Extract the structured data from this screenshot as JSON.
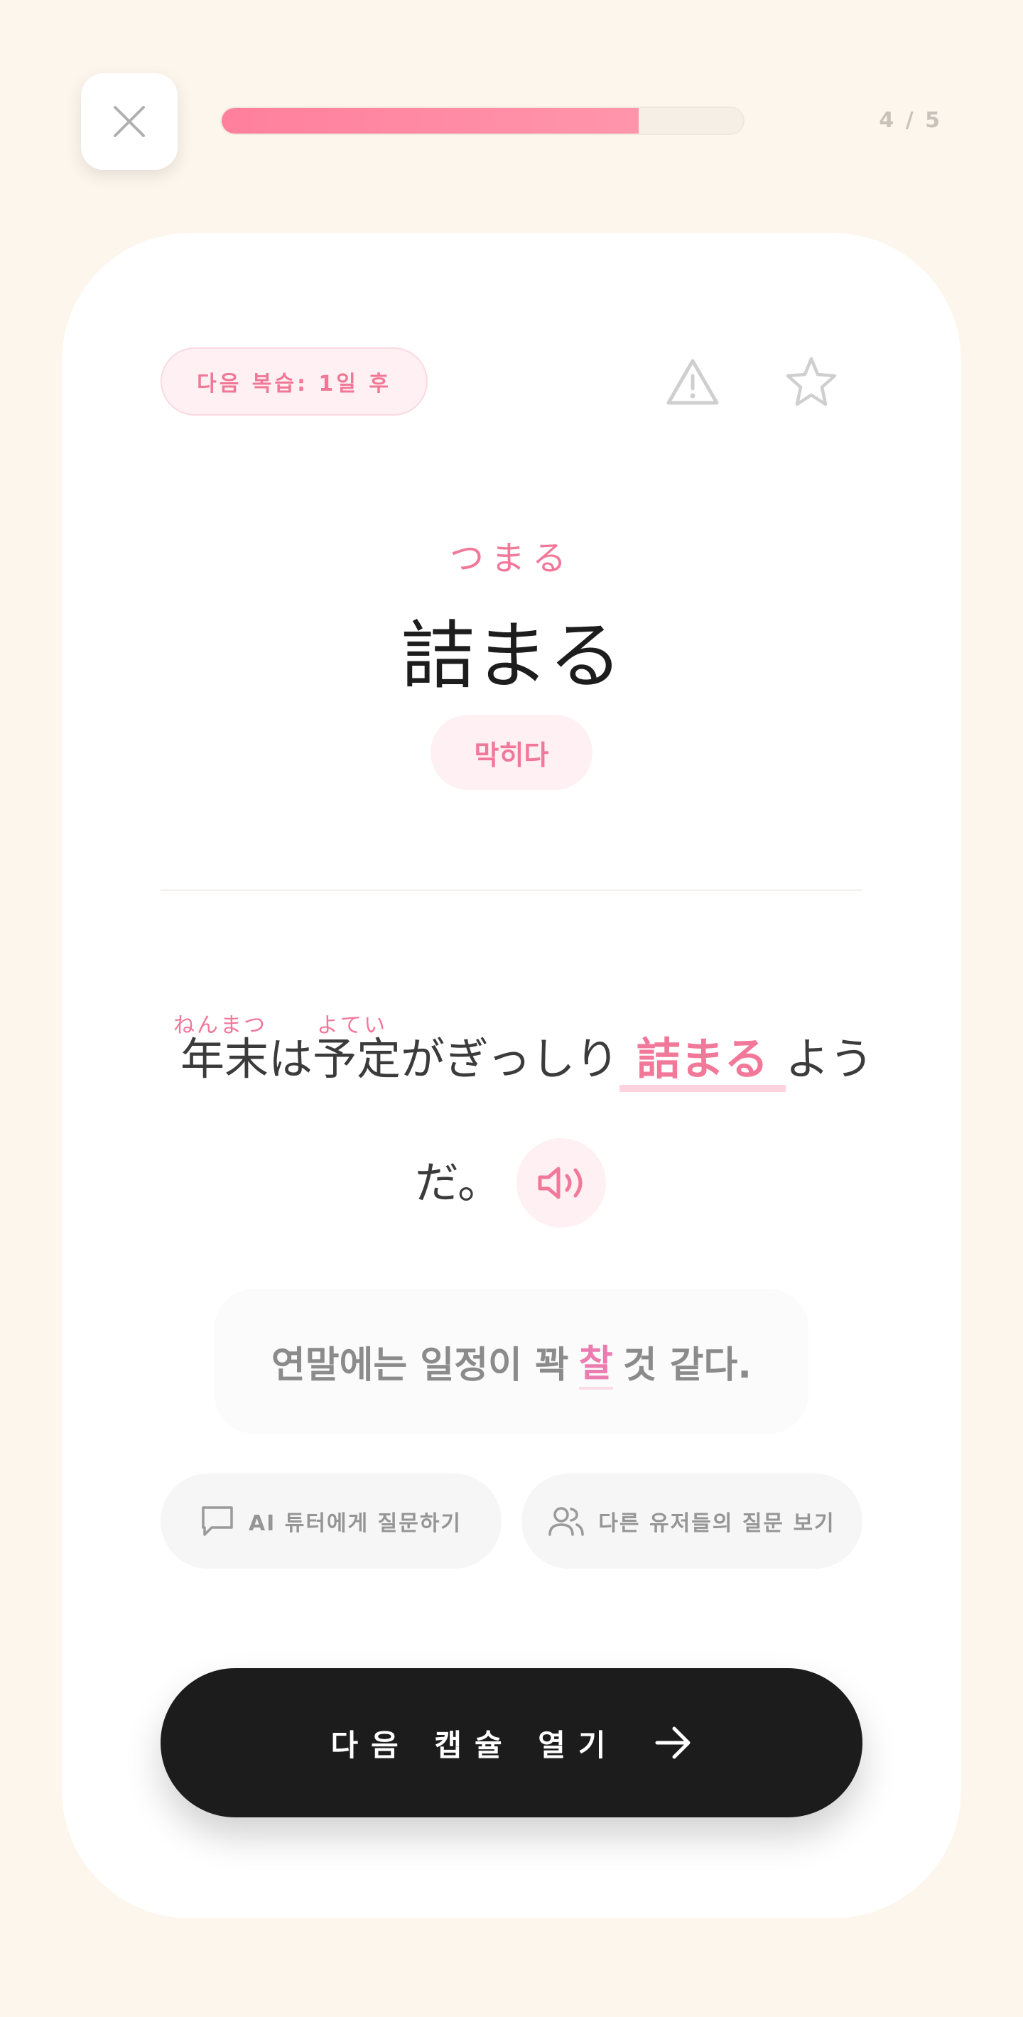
{
  "header": {
    "progress": {
      "current": 4,
      "total": 5,
      "fraction": 0.8,
      "label": "4 / 5"
    }
  },
  "card": {
    "review_badge": "다음 복습: 1일 후",
    "reading": "つまる",
    "word": "詰まる",
    "meaning": "막히다",
    "example": {
      "furigana_1": "ねんまつ",
      "furigana_2": "よてい",
      "before": "年末は予定がぎっしり",
      "highlight": "詰まる",
      "after": "よう",
      "line2": "だ。"
    },
    "translation": {
      "before": "연말에는 일정이 꽉",
      "highlight": "찰",
      "after": "것 같다."
    },
    "ai_button": "AI 튜터에게 질문하기",
    "others_button": "다른 유저들의 질문 보기",
    "next_button": "다음 캡슐 열기"
  },
  "icons": {
    "close": "close-icon",
    "warning": "warning-icon",
    "star": "star-icon",
    "speaker": "speaker-icon",
    "chat": "chat-bubble-icon",
    "users": "users-icon",
    "arrow": "arrow-right-icon"
  },
  "colors": {
    "accent": "#f2789a",
    "background": "#fdf6ed",
    "primary_button": "#1c1c1c"
  }
}
